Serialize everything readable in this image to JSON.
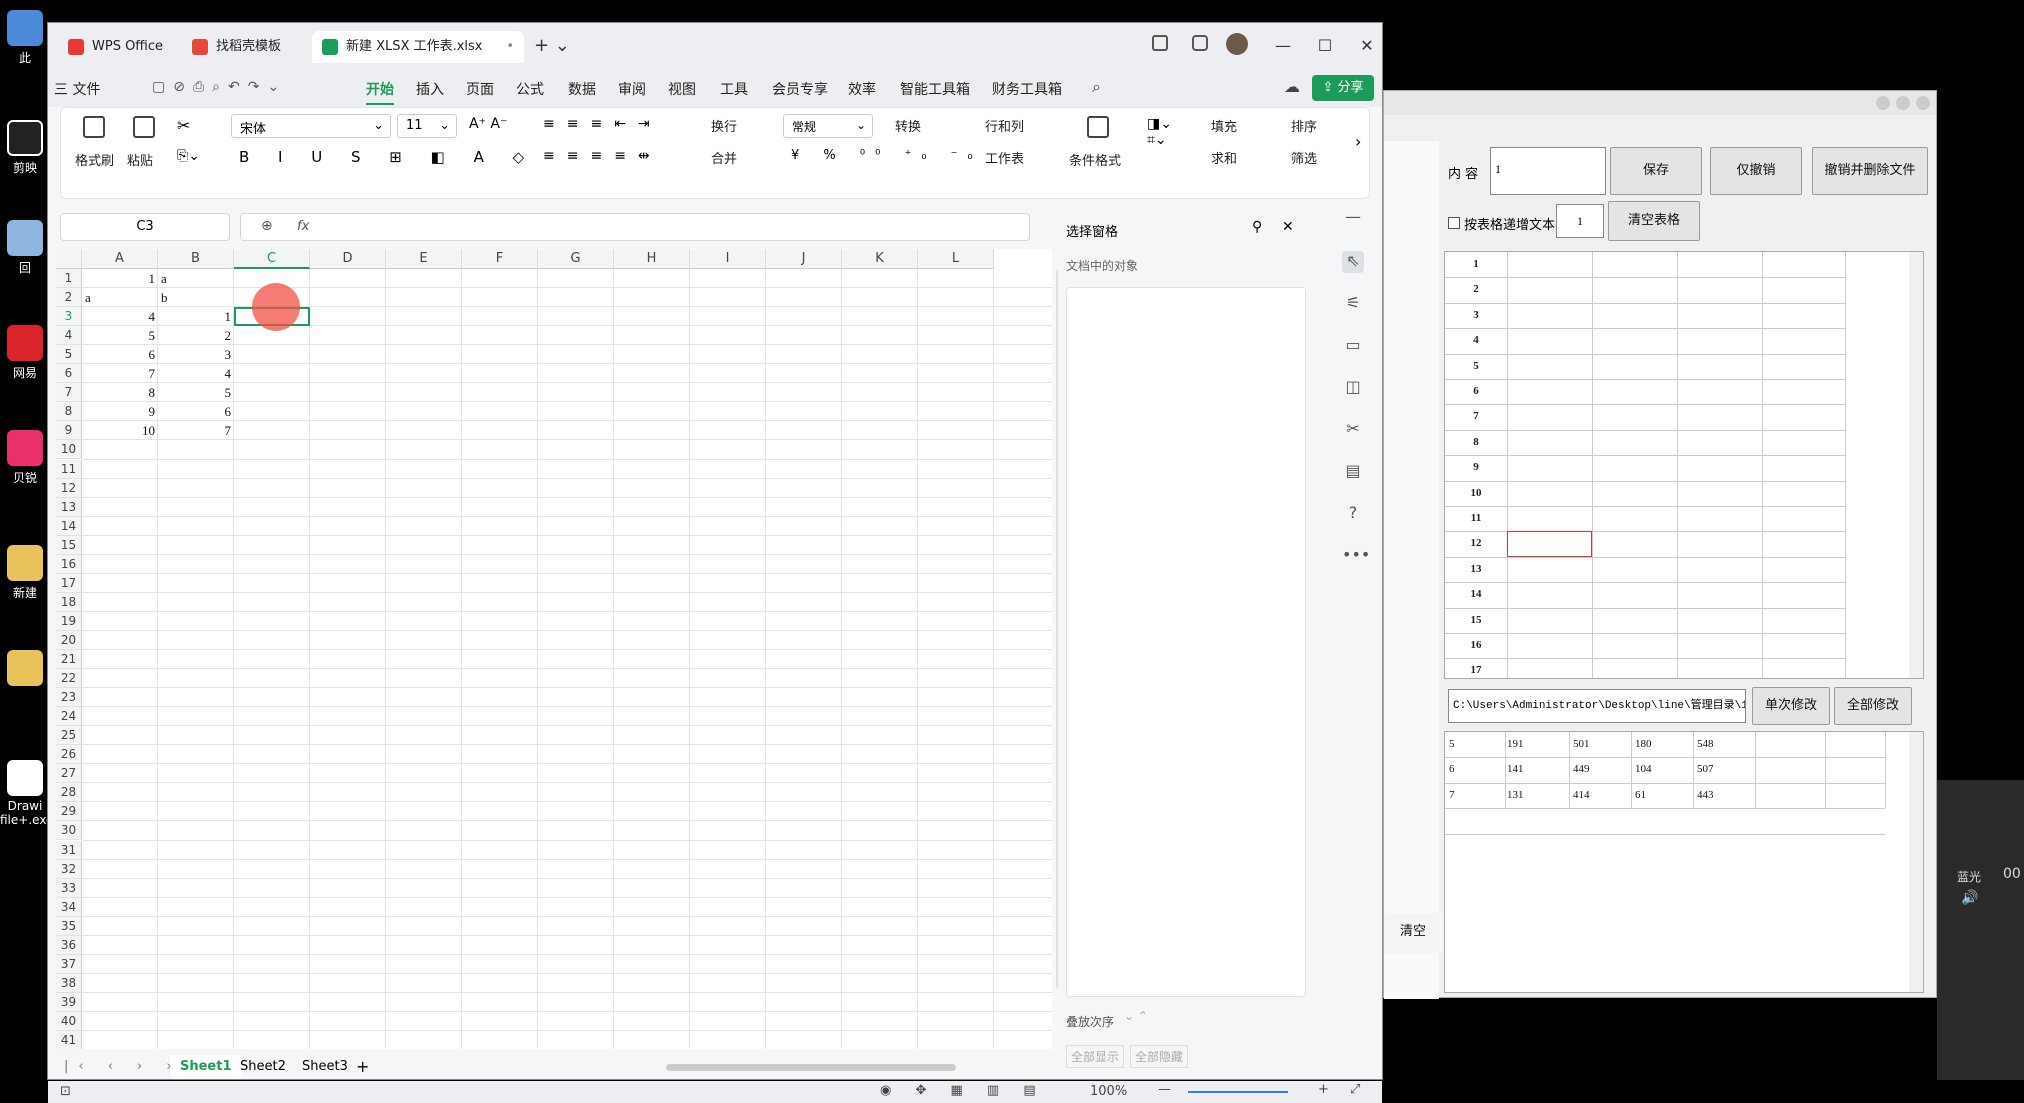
{
  "wps": {
    "tabs": [
      "WPS Office",
      "找稻壳模板",
      "新建 XLSX 工作表.xlsx"
    ],
    "menu": [
      "三 文件",
      "开始",
      "插入",
      "页面",
      "公式",
      "数据",
      "审阅",
      "视图",
      "工具",
      "会员专享",
      "效率",
      "智能工具箱",
      "财务工具箱"
    ],
    "share_label": "分享",
    "ribbon": {
      "format_painter": "格式刷",
      "paste": "粘贴",
      "font": "宋体",
      "size": "11",
      "wrap": "换行",
      "number_format": "常规",
      "convert": "转换",
      "rows_cols": "行和列",
      "merge": "合并",
      "worksheet": "工作表",
      "cond_format": "条件格式",
      "fill": "填充",
      "sort": "排序",
      "sum": "求和",
      "filter": "筛选"
    },
    "namebox": "C3",
    "fx": "fx",
    "columns": [
      "A",
      "B",
      "C",
      "D",
      "E",
      "F",
      "G",
      "H",
      "I",
      "J",
      "K",
      "L"
    ],
    "cells": [
      {
        "r": 1,
        "c": "A",
        "v": "1",
        "align": "right"
      },
      {
        "r": 1,
        "c": "B",
        "v": "a",
        "align": "left"
      },
      {
        "r": 2,
        "c": "A",
        "v": "a",
        "align": "left"
      },
      {
        "r": 2,
        "c": "B",
        "v": "b",
        "align": "left"
      },
      {
        "r": 3,
        "c": "A",
        "v": "4",
        "align": "right"
      },
      {
        "r": 3,
        "c": "B",
        "v": "1",
        "align": "right"
      },
      {
        "r": 4,
        "c": "A",
        "v": "5",
        "align": "right"
      },
      {
        "r": 4,
        "c": "B",
        "v": "2",
        "align": "right"
      },
      {
        "r": 5,
        "c": "A",
        "v": "6",
        "align": "right"
      },
      {
        "r": 5,
        "c": "B",
        "v": "3",
        "align": "right"
      },
      {
        "r": 6,
        "c": "A",
        "v": "7",
        "align": "right"
      },
      {
        "r": 6,
        "c": "B",
        "v": "4",
        "align": "right"
      },
      {
        "r": 7,
        "c": "A",
        "v": "8",
        "align": "right"
      },
      {
        "r": 7,
        "c": "B",
        "v": "5",
        "align": "right"
      },
      {
        "r": 8,
        "c": "A",
        "v": "9",
        "align": "right"
      },
      {
        "r": 8,
        "c": "B",
        "v": "6",
        "align": "right"
      },
      {
        "r": 9,
        "c": "A",
        "v": "10",
        "align": "right"
      },
      {
        "r": 9,
        "c": "B",
        "v": "7",
        "align": "right"
      }
    ],
    "row_count": 41,
    "sheets": [
      "Sheet1",
      "Sheet2",
      "Sheet3"
    ],
    "pane": {
      "title": "选择窗格",
      "subtitle": "文档中的对象",
      "order": "叠放次序",
      "show_all": "全部显示",
      "hide_all": "全部隐藏"
    },
    "zoom": "100%"
  },
  "tool": {
    "content_label": "内 容",
    "content_value": "1",
    "save": "保存",
    "undo_only": "仅撤销",
    "undo_delete": "撤销并删除文件",
    "checkbox_label": "按表格递增文本",
    "inc_value": "1",
    "clear_table": "清空表格",
    "row_numbers": [
      "1",
      "2",
      "3",
      "4",
      "5",
      "6",
      "7",
      "8",
      "9",
      "10",
      "11",
      "12",
      "13",
      "14",
      "15",
      "16",
      "17"
    ],
    "path": "C:\\Users\\Administrator\\Desktop\\line\\管理目录\\1",
    "single_edit": "单次修改",
    "all_edit": "全部修改",
    "rows": [
      [
        "5",
        "191",
        "501",
        "180",
        "548"
      ],
      [
        "6",
        "141",
        "449",
        "104",
        "507"
      ],
      [
        "7",
        "131",
        "414",
        "61",
        "443"
      ]
    ],
    "clear_btn": "清空"
  },
  "desktop": {
    "labels": [
      "此",
      "剪映",
      "回",
      "网易",
      "贝锐",
      "新建",
      "Drawi",
      "file+.exe"
    ],
    "right_labels": [
      "蓝光",
      "00"
    ]
  }
}
